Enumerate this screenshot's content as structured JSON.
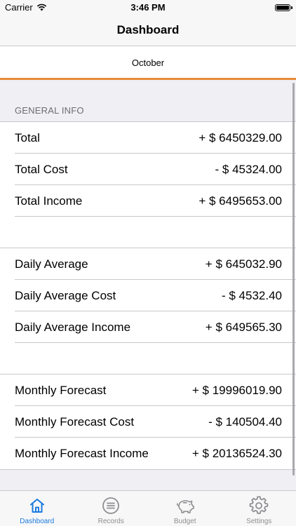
{
  "status_bar": {
    "carrier": "Carrier",
    "time": "3:46 PM"
  },
  "nav": {
    "title": "Dashboard"
  },
  "month_selector": {
    "label": "October"
  },
  "general_info": {
    "header": "GENERAL INFO",
    "rows": [
      {
        "label": "Total",
        "value": "+ $ 6450329.00"
      },
      {
        "label": "Total Cost",
        "value": "- $ 45324.00"
      },
      {
        "label": "Total Income",
        "value": "+ $ 6495653.00"
      },
      {
        "label": "Daily Average",
        "value": "+ $ 645032.90"
      },
      {
        "label": "Daily Average Cost",
        "value": "- $ 4532.40"
      },
      {
        "label": "Daily Average Income",
        "value": "+ $ 649565.30"
      },
      {
        "label": "Monthly Forecast",
        "value": "+ $ 19996019.90"
      },
      {
        "label": "Monthly Forecast Cost",
        "value": "- $ 140504.40"
      },
      {
        "label": "Monthly Forecast Income",
        "value": "+ $ 20136524.30"
      }
    ]
  },
  "tab_bar": {
    "tabs": [
      {
        "label": "Dashboard",
        "icon": "home-icon",
        "active": true
      },
      {
        "label": "Records",
        "icon": "list-icon",
        "active": false
      },
      {
        "label": "Budget",
        "icon": "piggy-bank-icon",
        "active": false
      },
      {
        "label": "Settings",
        "icon": "gear-icon",
        "active": false
      }
    ]
  },
  "colors": {
    "accent": "#1a7adf",
    "month_underline": "#e88b39",
    "inactive_tab": "#8e8e93"
  }
}
